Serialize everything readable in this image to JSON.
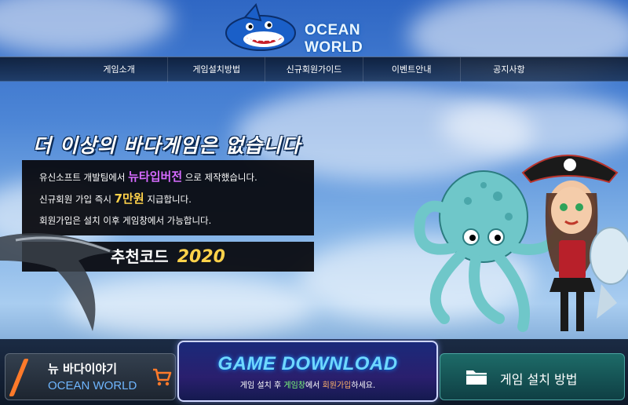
{
  "header": {
    "logo_text": "OCEAN WORLD"
  },
  "nav": {
    "items": [
      "게임소개",
      "게임설치방법",
      "신규회원가이드",
      "이벤트안내",
      "공지사항"
    ]
  },
  "hero": {
    "headline": "더 이상의 바다게임은 없습니다",
    "line1_pre": "유신소프트 개발팀에서",
    "line1_highlight": "뉴타입버전",
    "line1_post": "으로 제작했습니다.",
    "line2_pre": "신규회원 가입 즉시",
    "line2_highlight": "7만원",
    "line2_post": "지급합니다.",
    "line3": "회원가입은 설치 이후 게임창에서 가능합니다.",
    "code_label": "추천코드",
    "code_value": "2020"
  },
  "bottom": {
    "left_title": "뉴 바다이야기",
    "left_subtitle": "OCEAN WORLD",
    "center_title": "GAME DOWNLOAD",
    "center_sub_pre": "게임 설치 후",
    "center_sub_g": "게임창",
    "center_sub_mid": "에서",
    "center_sub_o": "회원가입",
    "center_sub_post": "하세요.",
    "right_title": "게임 설치 방법"
  },
  "colors": {
    "accent_yellow": "#ffd24a",
    "accent_purple": "#d66bff",
    "accent_orange": "#ff7a2a",
    "accent_cyan": "#6fd8ff"
  }
}
